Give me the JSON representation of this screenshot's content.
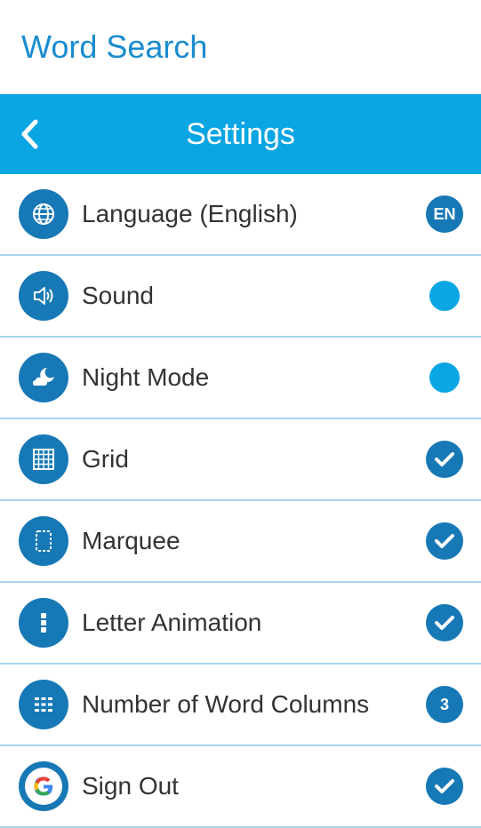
{
  "app": {
    "title": "Word Search"
  },
  "header": {
    "title": "Settings"
  },
  "settings": [
    {
      "label": "Language (English)",
      "control": "badge",
      "badge": "EN"
    },
    {
      "label": "Sound",
      "control": "off"
    },
    {
      "label": "Night Mode",
      "control": "off"
    },
    {
      "label": "Grid",
      "control": "check"
    },
    {
      "label": "Marquee",
      "control": "check"
    },
    {
      "label": "Letter Animation",
      "control": "check"
    },
    {
      "label": "Number of Word Columns",
      "control": "badge",
      "badge": "3"
    },
    {
      "label": "Sign Out",
      "control": "check"
    }
  ],
  "colors": {
    "accent": "#0aa5e3",
    "icon_bg": "#1778b6",
    "title": "#1a8ccf",
    "divider": "#a9d4ef"
  }
}
